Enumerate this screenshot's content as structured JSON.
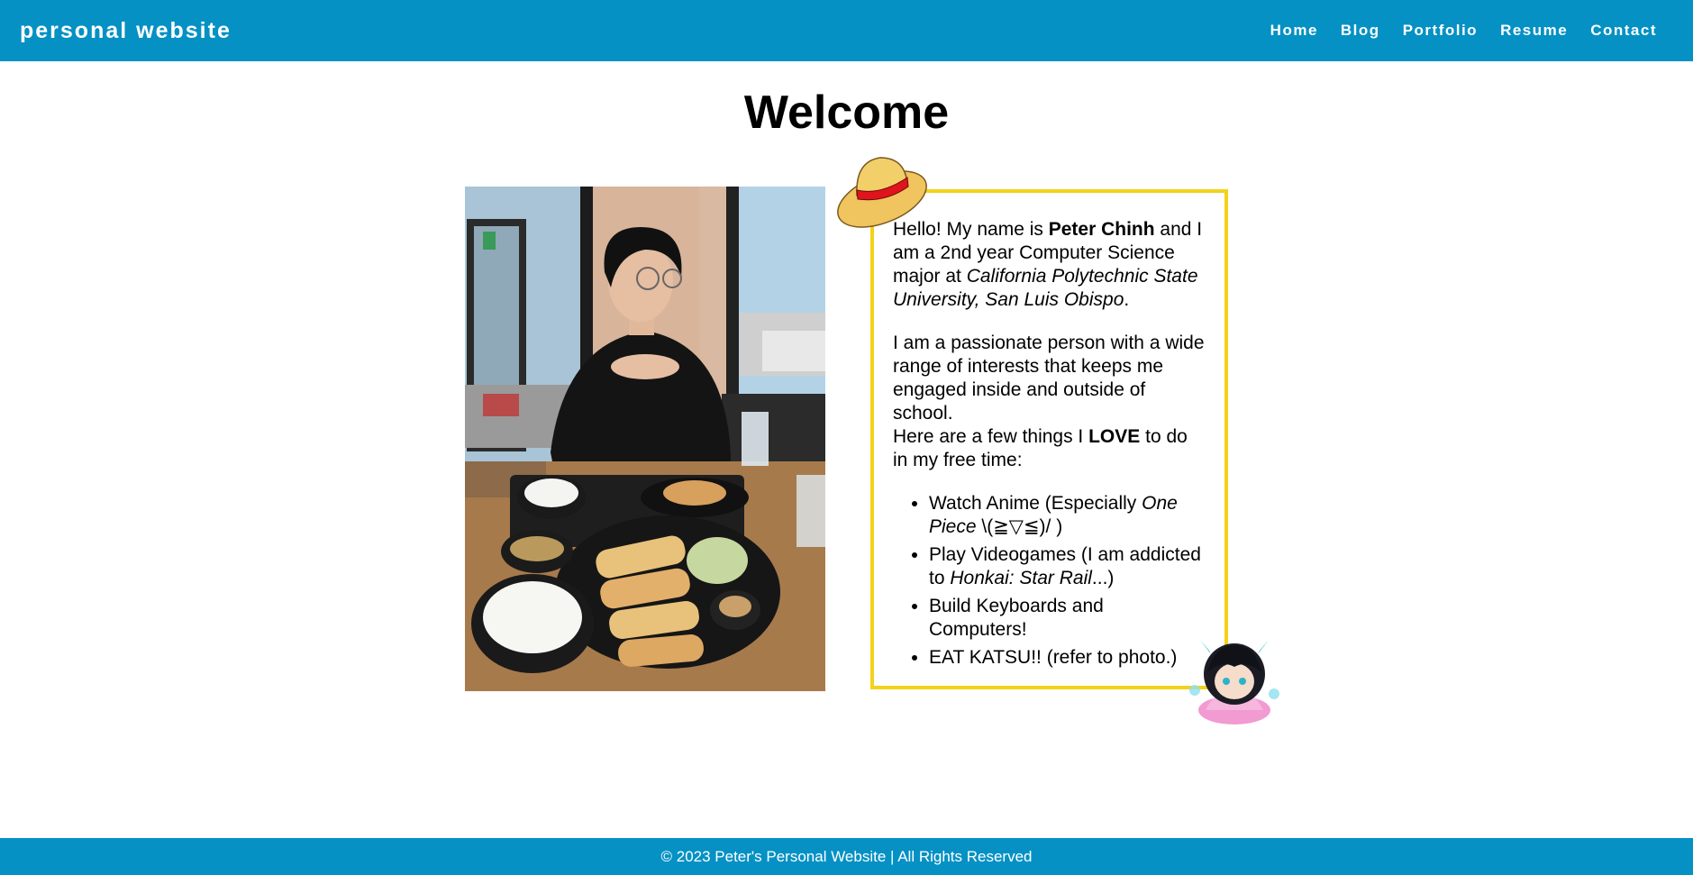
{
  "header": {
    "brand": "personal website",
    "nav": [
      "Home",
      "Blog",
      "Portfolio",
      "Resume",
      "Contact"
    ]
  },
  "main": {
    "title": "Welcome",
    "intro": {
      "t1": "Hello! My name is ",
      "name": "Peter Chinh",
      "t2": " and I am a 2nd year Computer Science major at ",
      "school": "California Polytechnic State University, San Luis Obispo",
      "t3": "."
    },
    "passion": "I am a passionate person with a wide range of interests that keeps me engaged inside and outside of school.",
    "love": {
      "t1": "Here are a few things I ",
      "bold": "LOVE",
      "t2": " to do in my free time:"
    },
    "hobbies": {
      "anime": {
        "t1": "Watch Anime (Especially ",
        "italic": "One Piece",
        "t2": " \\(≧▽≦)/ )"
      },
      "games": {
        "t1": "Play Videogames (I am addicted to ",
        "italic": "Honkai: Star Rail",
        "t2": "...)"
      },
      "keyboards": "Build Keyboards and Computers!",
      "katsu": "EAT KATSU!! (refer to photo.)"
    }
  },
  "footer": {
    "text": "© 2023 Peter's Personal Website | All Rights Reserved"
  },
  "colors": {
    "header_bg": "#0591c4",
    "box_border": "#f3d21a"
  },
  "icons": [
    "straw-hat-icon",
    "chibi-character-icon"
  ]
}
